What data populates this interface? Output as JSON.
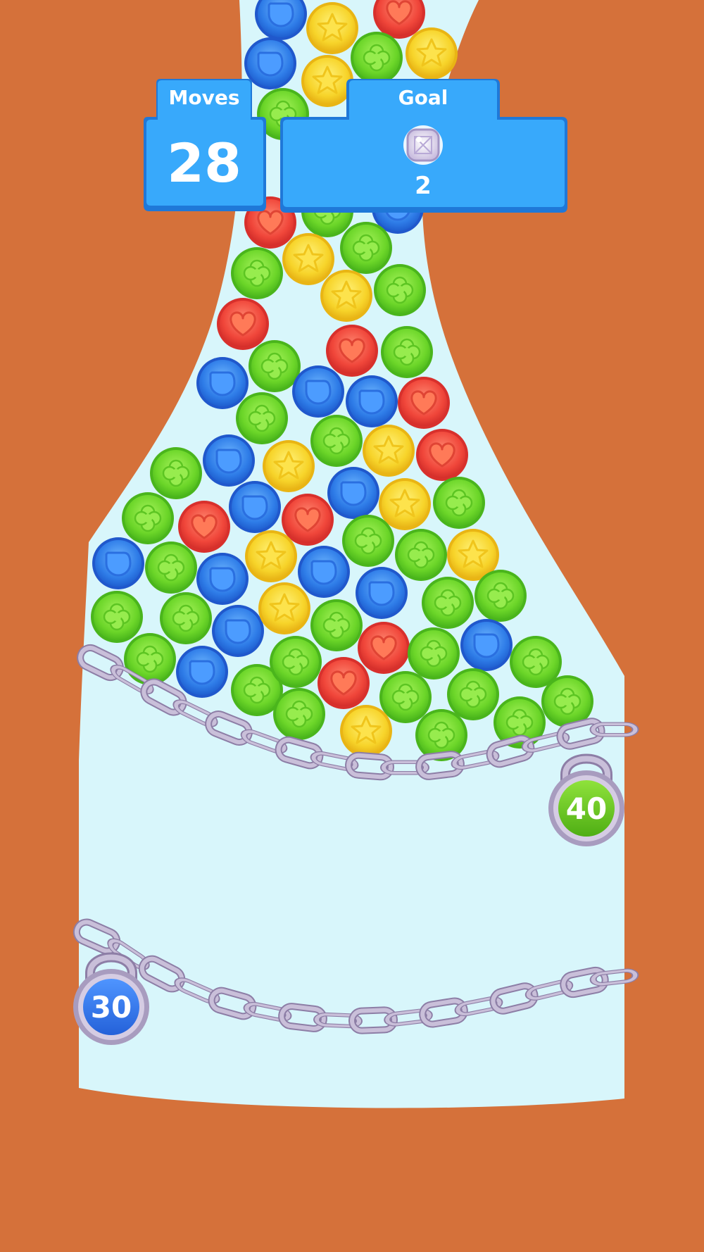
{
  "hud": {
    "moves_label": "Moves",
    "moves_value": "28",
    "goal_label": "Goal",
    "goal_count": "2",
    "goal_item": "white-gem-icon"
  },
  "locks": [
    {
      "name": "lock-40",
      "value": "40",
      "color": "green"
    },
    {
      "name": "lock-30",
      "value": "30",
      "color": "blue"
    }
  ],
  "piece_types": {
    "star": {
      "color": "#f7d42a",
      "icon": "star-icon"
    },
    "heart": {
      "color": "#f0463a",
      "icon": "heart-icon"
    },
    "drop": {
      "color": "#2f7de8",
      "icon": "drop-icon"
    },
    "clover": {
      "color": "#6cd629",
      "icon": "clover-icon"
    }
  },
  "colors": {
    "background": "#d5713a",
    "board": "#d8f6fb",
    "hud_blue": "#38a9fb",
    "chain": "#b4a8c6"
  }
}
